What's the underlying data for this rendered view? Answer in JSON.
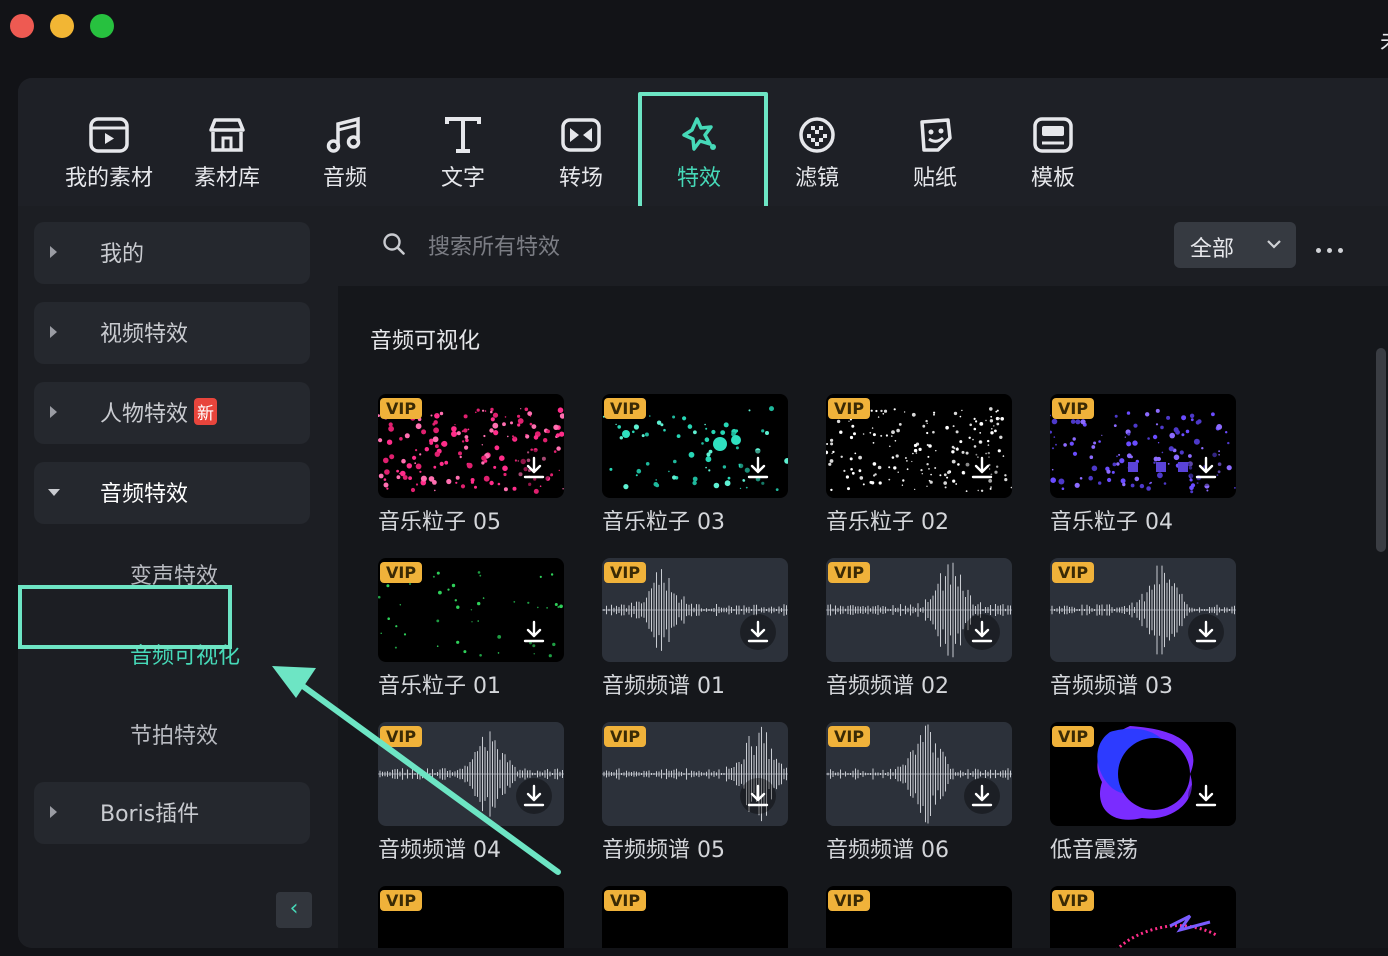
{
  "window": {
    "title_fragment": "未"
  },
  "topnav": {
    "tabs": [
      {
        "id": "my-media",
        "label": "我的素材",
        "icon": "media-icon"
      },
      {
        "id": "stock-media",
        "label": "素材库",
        "icon": "store-icon"
      },
      {
        "id": "audio",
        "label": "音频",
        "icon": "music-note-icon"
      },
      {
        "id": "titles",
        "label": "文字",
        "icon": "text-icon"
      },
      {
        "id": "transitions",
        "label": "转场",
        "icon": "transition-icon"
      },
      {
        "id": "effects",
        "label": "特效",
        "icon": "sparkle-icon",
        "active": true
      },
      {
        "id": "filters",
        "label": "滤镜",
        "icon": "filter-icon"
      },
      {
        "id": "stickers",
        "label": "贴纸",
        "icon": "sticker-icon"
      },
      {
        "id": "templates",
        "label": "模板",
        "icon": "template-icon"
      }
    ]
  },
  "sidebar": {
    "categories": [
      {
        "label": "我的"
      },
      {
        "label": "视频特效"
      },
      {
        "label": "人物特效",
        "badge": "新"
      },
      {
        "label": "音频特效",
        "open": true
      },
      {
        "label": "Boris插件"
      }
    ],
    "subitems": [
      {
        "label": "变声特效"
      },
      {
        "label": "音频可视化",
        "active": true
      },
      {
        "label": "节拍特效"
      }
    ]
  },
  "search": {
    "placeholder": "搜索所有特效",
    "filter_label": "全部"
  },
  "section": {
    "title": "音频可视化"
  },
  "badge_vip": "VIP",
  "colors": {
    "accent": "#46d9b8",
    "highlight": "#6de5c4",
    "vip": "#f0b23a",
    "new_badge": "#e8453c"
  },
  "cards": [
    {
      "title": "音乐粒子 05",
      "style": "particles-pink"
    },
    {
      "title": "音乐粒子 03",
      "style": "particles-teal"
    },
    {
      "title": "音乐粒子 02",
      "style": "particles-white"
    },
    {
      "title": "音乐粒子 04",
      "style": "particles-purple"
    },
    {
      "title": "音乐粒子 01",
      "style": "particles-green"
    },
    {
      "title": "音频频谱 01",
      "style": "waveform"
    },
    {
      "title": "音频频谱 02",
      "style": "waveform"
    },
    {
      "title": "音频频谱 03",
      "style": "waveform"
    },
    {
      "title": "音频频谱 04",
      "style": "waveform"
    },
    {
      "title": "音频频谱 05",
      "style": "waveform"
    },
    {
      "title": "音频频谱 06",
      "style": "waveform"
    },
    {
      "title": "低音震荡",
      "style": "bass-ring"
    },
    {
      "title": "",
      "style": "bars-white"
    },
    {
      "title": "",
      "style": "bars-gradient"
    },
    {
      "title": "",
      "style": "bars-pink"
    },
    {
      "title": "",
      "style": "ring-neon"
    }
  ]
}
